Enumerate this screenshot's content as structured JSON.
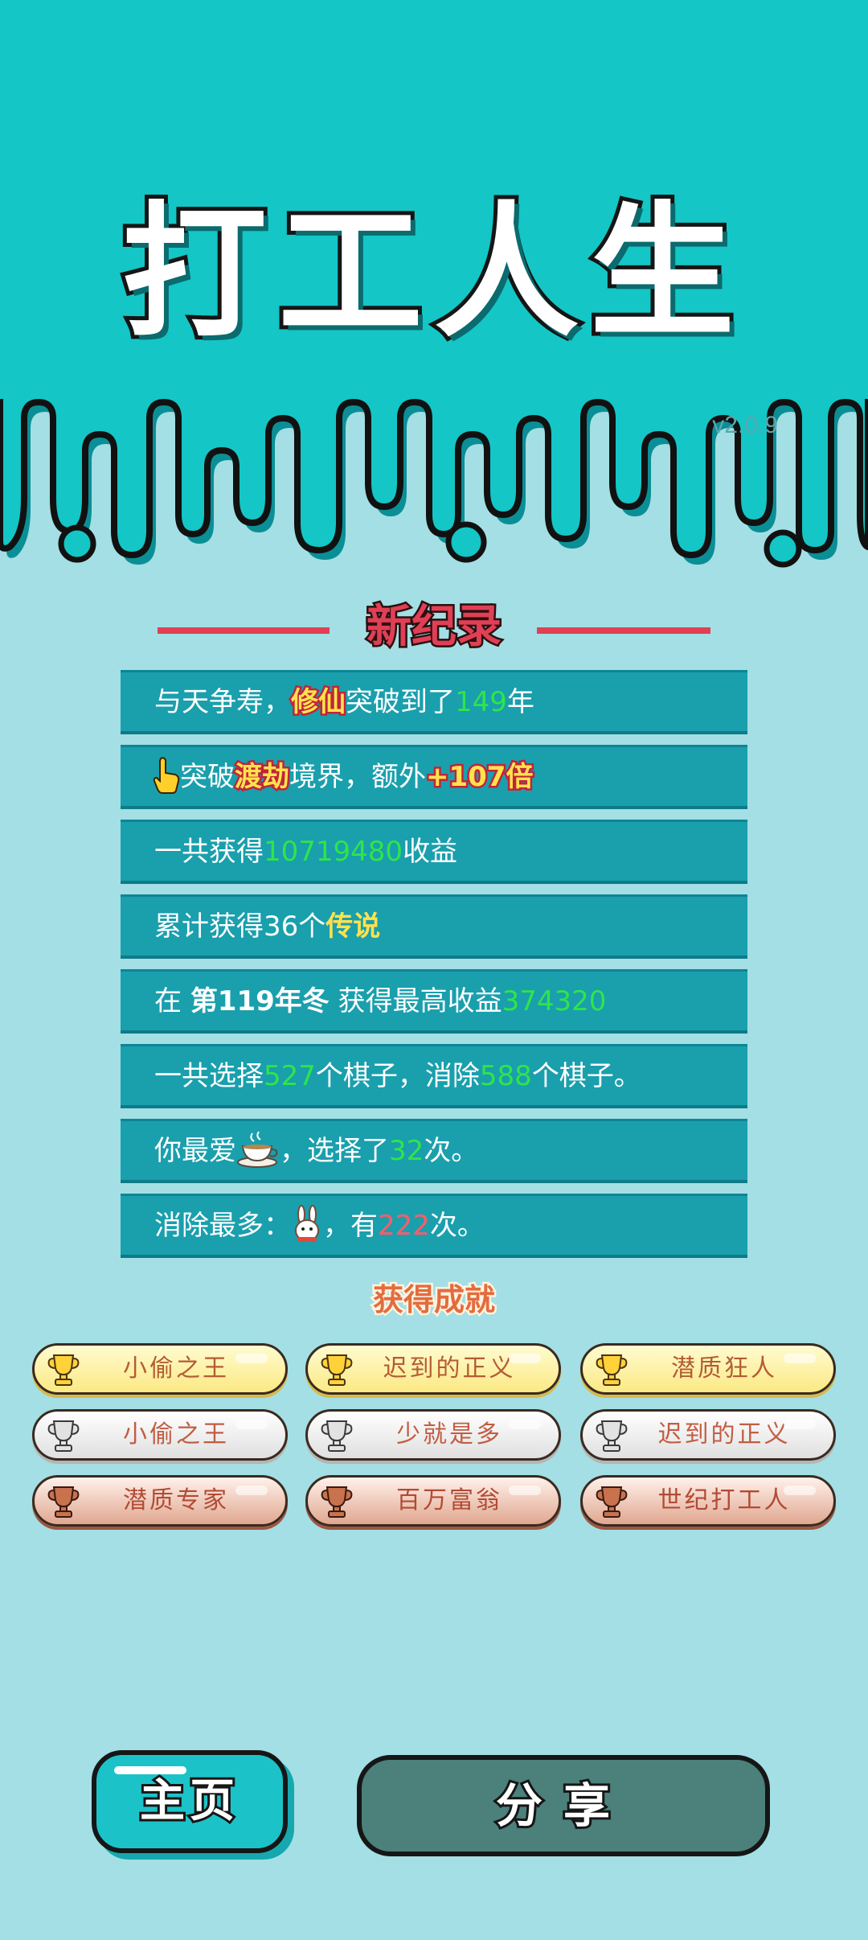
{
  "header": {
    "title": "打工人生",
    "version": "v2.0.9",
    "bg_color": "#14c6c6"
  },
  "record": {
    "title": "新纪录",
    "rows": [
      {
        "parts": [
          "与天争寿，",
          "修仙",
          "突破到了",
          "149",
          "年"
        ]
      },
      {
        "parts": [
          "突破",
          "渡劫",
          "境界，额外",
          "+107倍"
        ],
        "icon": "pointing-hand-icon"
      },
      {
        "parts": [
          "一共获得",
          "10719480",
          "收益"
        ]
      },
      {
        "parts": [
          "累计获得36个",
          "传说"
        ]
      },
      {
        "parts": [
          "在 ",
          "第119年冬",
          " 获得最高收益",
          "374320"
        ]
      },
      {
        "parts": [
          "一共选择",
          "527",
          "个棋子，消除",
          "588",
          "个棋子。"
        ]
      },
      {
        "parts": [
          "你最爱",
          "，选择了",
          "32",
          "次。"
        ],
        "icon": "teacup-icon"
      },
      {
        "parts": [
          "消除最多：",
          "，有",
          "222",
          "次。"
        ],
        "icon": "rabbit-icon"
      }
    ]
  },
  "achievements": {
    "title": "获得成就",
    "items": [
      {
        "label": "小偷之王",
        "tier": "gold"
      },
      {
        "label": "迟到的正义",
        "tier": "gold"
      },
      {
        "label": "潜质狂人",
        "tier": "gold"
      },
      {
        "label": "小偷之王",
        "tier": "silver"
      },
      {
        "label": "少就是多",
        "tier": "silver"
      },
      {
        "label": "迟到的正义",
        "tier": "silver"
      },
      {
        "label": "潜质专家",
        "tier": "bronze"
      },
      {
        "label": "百万富翁",
        "tier": "bronze"
      },
      {
        "label": "世纪打工人",
        "tier": "bronze"
      }
    ]
  },
  "buttons": {
    "home": "主页",
    "share": "分享"
  }
}
